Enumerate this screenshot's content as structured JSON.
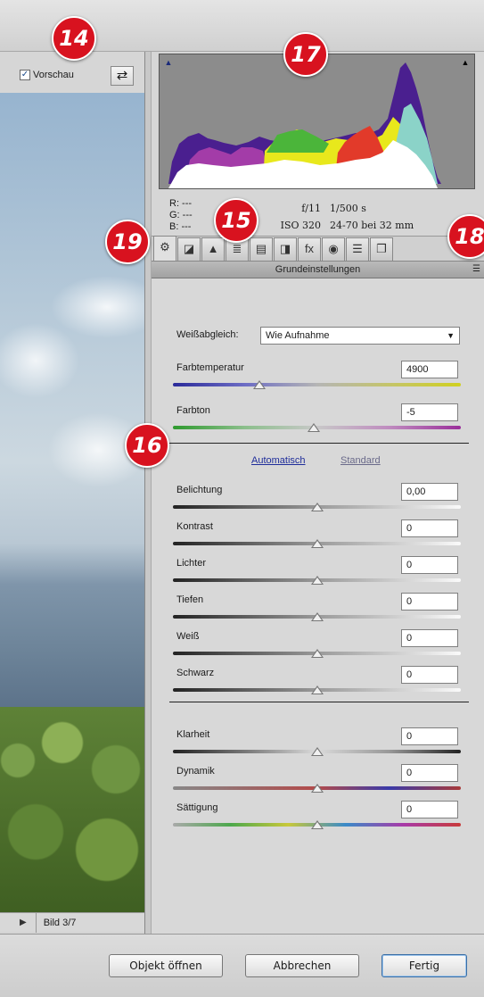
{
  "toolbar": {
    "preview_label": "Vorschau",
    "preview_checked": "✓",
    "swap_glyph": "⇄"
  },
  "photo_nav": {
    "prev": "◀",
    "next": "▶",
    "image_label": "Bild 3/7"
  },
  "histogram": {
    "clip_left": "▲",
    "clip_right": "▲",
    "r": "R:  ---",
    "g": "G:  ---",
    "b": "B:  ---",
    "aperture": "f/11",
    "shutter": "1/500 s",
    "iso": "ISO 320",
    "lens": "24-70 bei 32 mm"
  },
  "tabs": [
    "⚙",
    "◪",
    "▲",
    "≣",
    "▤",
    "◨",
    "fx",
    "◉",
    "☰",
    "❐"
  ],
  "panel": {
    "title": "Grundeinstellungen",
    "menu_glyph": "☰",
    "wb_label": "Weißabgleich:",
    "wb_value": "Wie Aufnahme",
    "wb_arrow": "▼",
    "auto_link": "Automatisch",
    "std_link": "Standard",
    "sliders": [
      {
        "label": "Farbtemperatur",
        "value": "4900",
        "position": 0.3
      },
      {
        "label": "Farbton",
        "value": "-5",
        "position": 0.49
      },
      {
        "label": "Belichtung",
        "value": "0,00",
        "position": 0.5
      },
      {
        "label": "Kontrast",
        "value": "0",
        "position": 0.5
      },
      {
        "label": "Lichter",
        "value": "0",
        "position": 0.5
      },
      {
        "label": "Tiefen",
        "value": "0",
        "position": 0.5
      },
      {
        "label": "Weiß",
        "value": "0",
        "position": 0.5
      },
      {
        "label": "Schwarz",
        "value": "0",
        "position": 0.5
      },
      {
        "label": "Klarheit",
        "value": "0",
        "position": 0.5
      },
      {
        "label": "Dynamik",
        "value": "0",
        "position": 0.5
      },
      {
        "label": "Sättigung",
        "value": "0",
        "position": 0.5
      }
    ]
  },
  "buttons": {
    "open": "Objekt öffnen",
    "cancel": "Abbrechen",
    "done": "Fertig"
  },
  "callouts": {
    "c14": "14",
    "c15": "15",
    "c16": "16",
    "c17": "17",
    "c18": "18",
    "c19": "19"
  },
  "colors": {
    "callout": "#d8121f",
    "link": "#1f2d9a"
  }
}
